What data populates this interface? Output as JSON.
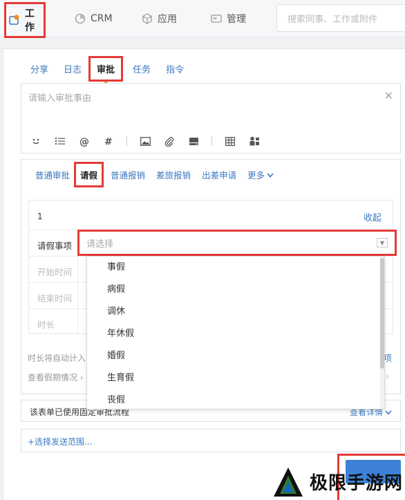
{
  "nav": {
    "work": "工作",
    "crm": "CRM",
    "app": "应用",
    "admin": "管理",
    "search_placeholder": "搜索同事、工作或附件"
  },
  "tabs": [
    "分享",
    "日志",
    "审批",
    "任务",
    "指令"
  ],
  "editor": {
    "placeholder": "请输入审批事由",
    "close": "×"
  },
  "subtabs": [
    "普通审批",
    "请假",
    "普通报销",
    "差旅报销",
    "出差申请",
    "更多"
  ],
  "form": {
    "row_num": "1",
    "collapse": "收起",
    "leave_type_label": "请假事项",
    "select_placeholder": "请选择",
    "start_label": "开始时间",
    "end_label": "结束时间",
    "duration_label": "时长"
  },
  "dropdown_options": [
    "事假",
    "病假",
    "调休",
    "年休假",
    "婚假",
    "生育假",
    "丧假"
  ],
  "notes": {
    "auto_calc": "时长将自动计入",
    "auto_calc_right": "项",
    "check_leave": "查看假期情况 ›",
    "check_right": "›"
  },
  "flow": {
    "text": "该表单已使用固定审批流程",
    "detail": "查看详情"
  },
  "scope": {
    "text": "+选择发送范围..."
  },
  "watermark": {
    "text": "极限手游网"
  },
  "colors": {
    "accent_blue": "#3a78c2",
    "highlight_red": "#e53935",
    "orange": "#f08a24",
    "button_blue": "#3d82d8"
  }
}
